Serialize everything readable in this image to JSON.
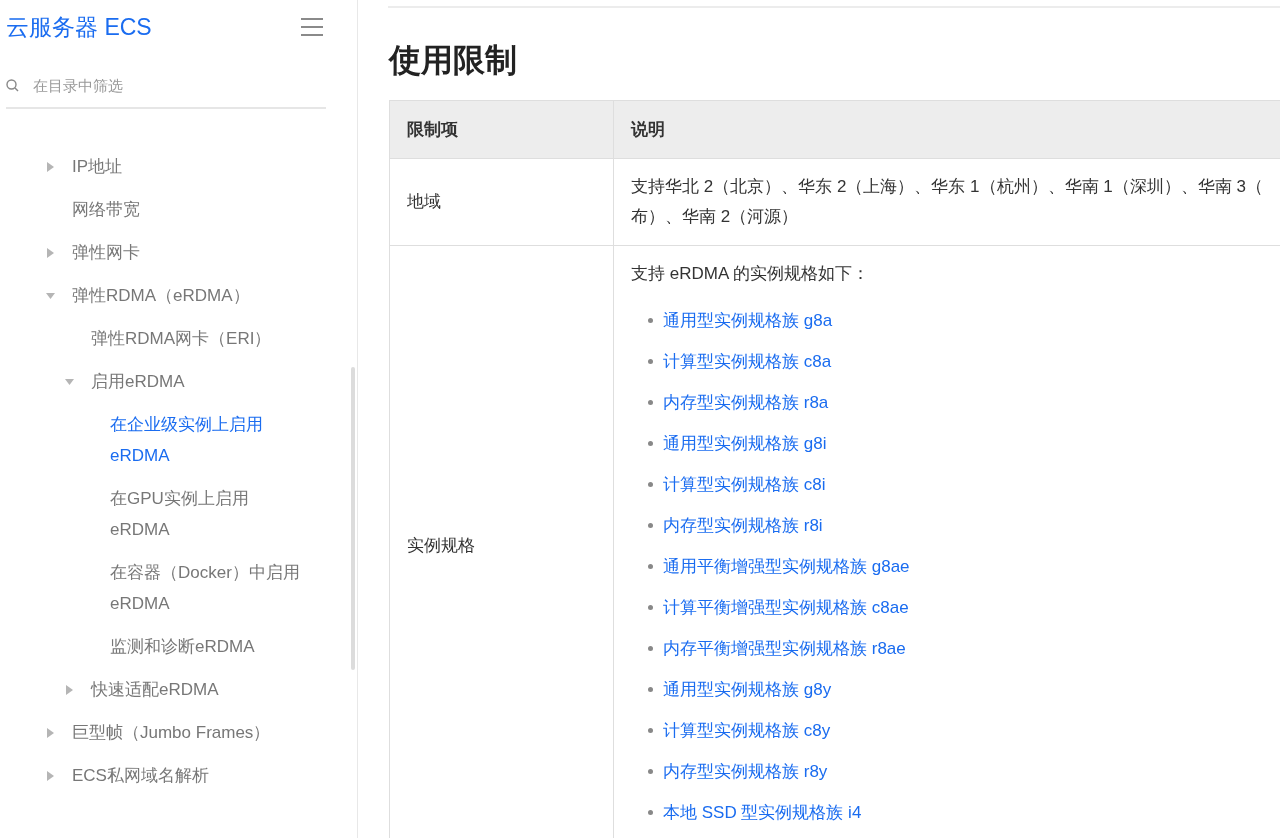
{
  "sidebar": {
    "title": "云服务器 ECS",
    "filter": {
      "placeholder": "在目录中筛选"
    },
    "tree": [
      {
        "label": "IP地址",
        "expanded": false,
        "selected": false
      },
      {
        "label": "网络带宽",
        "selected": false
      },
      {
        "label": "弹性网卡",
        "expanded": false,
        "selected": false
      },
      {
        "label": "弹性RDMA（eRDMA）",
        "expanded": true,
        "selected": false,
        "children": [
          {
            "label": "弹性RDMA网卡（ERI）",
            "selected": false
          },
          {
            "label": "启用eRDMA",
            "expanded": true,
            "selected": false,
            "children": [
              {
                "lines": [
                  "在企业级实例上启用",
                  "eRDMA"
                ],
                "selected": true
              },
              {
                "lines": [
                  "在GPU实例上启用",
                  "eRDMA"
                ],
                "selected": false
              },
              {
                "lines": [
                  "在容器（Docker）中启用",
                  "eRDMA"
                ],
                "selected": false
              },
              {
                "label": "监测和诊断eRDMA",
                "selected": false
              }
            ]
          },
          {
            "label": "快速适配eRDMA",
            "expanded": false,
            "selected": false
          }
        ]
      },
      {
        "label": "巨型帧（Jumbo Frames）",
        "expanded": false,
        "selected": false
      },
      {
        "label": "ECS私网域名解析",
        "expanded": false,
        "selected": false
      }
    ]
  },
  "main": {
    "heading": "使用限制",
    "table": {
      "columns": [
        "限制项",
        "说明"
      ],
      "rows": [
        {
          "item": "地域",
          "lines": [
            "支持华北 2（北京）、华东 2（上海）、华东 1（杭州）、华南 1（深圳）、华南 3（",
            "布）、华南 2（河源）"
          ]
        },
        {
          "item": "实例规格",
          "intro": "支持 eRDMA 的实例规格如下：",
          "links": [
            "通用型实例规格族 g8a",
            "计算型实例规格族 c8a",
            "内存型实例规格族 r8a",
            "通用型实例规格族 g8i",
            "计算型实例规格族 c8i",
            "内存型实例规格族 r8i",
            "通用平衡增强型实例规格族 g8ae",
            "计算平衡增强型实例规格族 c8ae",
            "内存平衡增强型实例规格族 r8ae",
            "通用型实例规格族 g8y",
            "计算型实例规格族 c8y",
            "内存型实例规格族 r8y",
            "本地 SSD 型实例规格族 i4"
          ]
        }
      ]
    }
  }
}
